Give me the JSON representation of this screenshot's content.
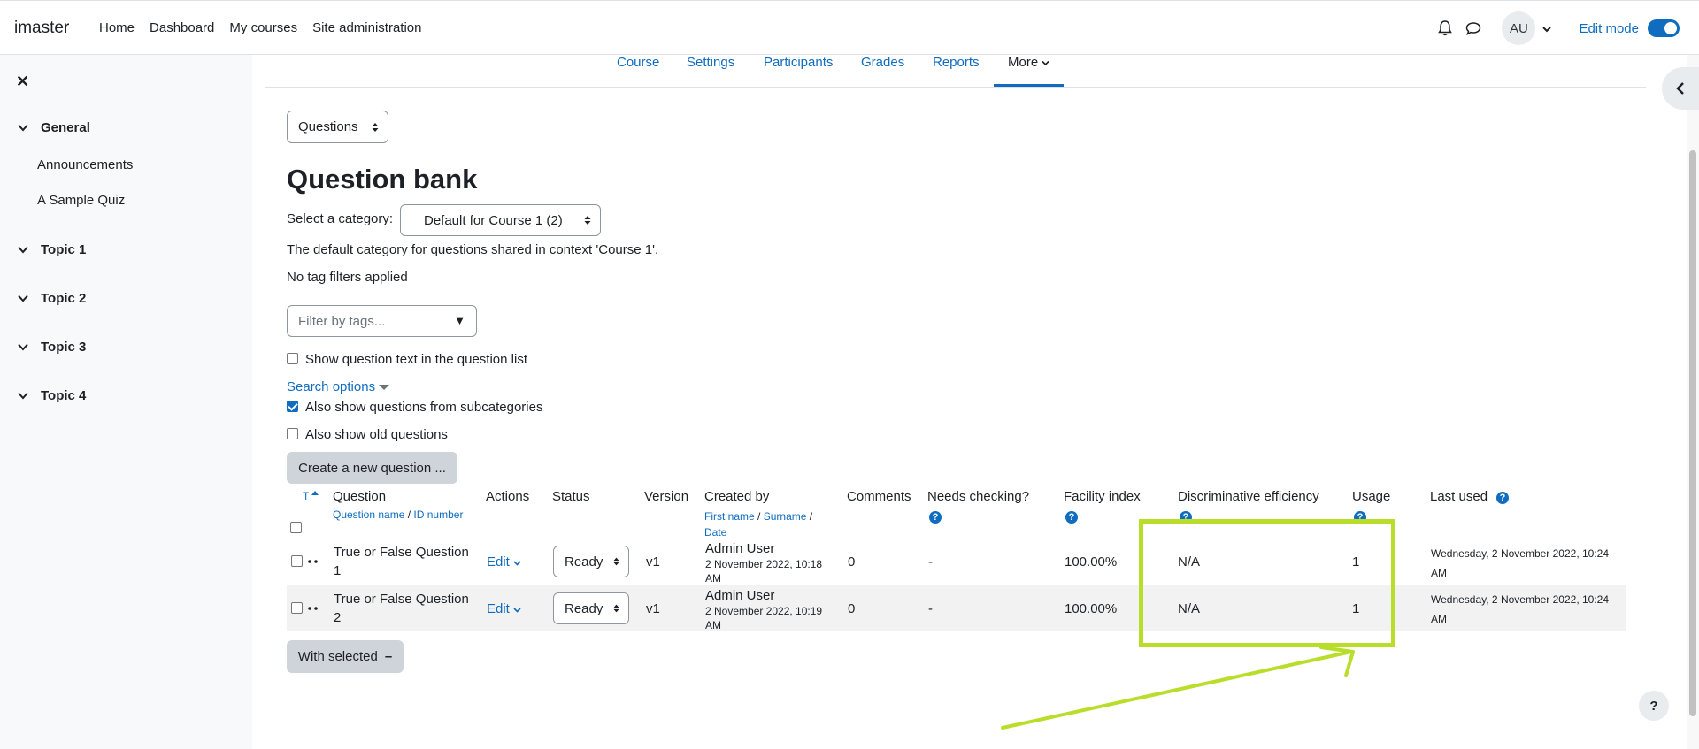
{
  "navbar": {
    "brand": "imaster",
    "links": [
      "Home",
      "Dashboard",
      "My courses",
      "Site administration"
    ],
    "avatar_initials": "AU",
    "edit_mode_label": "Edit mode",
    "edit_mode_on": true
  },
  "drawer": {
    "close_icon": "close-icon",
    "sections": [
      {
        "label": "General",
        "items": [
          "Announcements",
          "A Sample Quiz"
        ]
      },
      {
        "label": "Topic 1",
        "items": []
      },
      {
        "label": "Topic 2",
        "items": []
      },
      {
        "label": "Topic 3",
        "items": []
      },
      {
        "label": "Topic 4",
        "items": []
      }
    ]
  },
  "secondary_nav": {
    "items": [
      "Course",
      "Settings",
      "Participants",
      "Grades",
      "Reports",
      "More"
    ],
    "active": "More"
  },
  "bank_select": "Questions",
  "title": "Question bank",
  "category": {
    "label": "Select a category:",
    "value": "Default for Course 1 (2)",
    "description": "The default category for questions shared in context 'Course 1'."
  },
  "tags": {
    "status": "No tag filters applied",
    "placeholder": "Filter by tags..."
  },
  "options": {
    "show_text_label": "Show question text in the question list",
    "show_text_checked": false,
    "search_options_label": "Search options",
    "subcategories_label": "Also show questions from subcategories",
    "subcategories_checked": true,
    "old_label": "Also show old questions",
    "old_checked": false
  },
  "create_button": "Create a new question ...",
  "table": {
    "headers": {
      "type": "T",
      "question": "Question",
      "question_sub_name": "Question name",
      "question_sub_sep": "/",
      "question_sub_id": "ID number",
      "actions": "Actions",
      "status": "Status",
      "version": "Version",
      "created_by": "Created by",
      "created_sub_first": "First name",
      "created_sub_sep1": "/",
      "created_sub_surname": "Surname",
      "created_sub_sep2": "/",
      "created_sub_date": "Date",
      "comments": "Comments",
      "needs_checking": "Needs checking?",
      "facility": "Facility index",
      "discrimination": "Discriminative efficiency",
      "usage": "Usage",
      "last_used": "Last used"
    },
    "rows": [
      {
        "name_line1": "True or False Question",
        "name_line2": "1",
        "action": "Edit",
        "status": "Ready",
        "version": "v1",
        "creator": "Admin User",
        "created_line1": "2 November 2022, 10:18",
        "created_line2": "AM",
        "comments": "0",
        "needs_checking": "-",
        "facility": "100.00%",
        "discrimination": "N/A",
        "usage": "1",
        "last_used_line1": "Wednesday, 2 November 2022, 10:24",
        "last_used_line2": "AM"
      },
      {
        "name_line1": "True or False Question",
        "name_line2": "2",
        "action": "Edit",
        "status": "Ready",
        "version": "v1",
        "creator": "Admin User",
        "created_line1": "2 November 2022, 10:19",
        "created_line2": "AM",
        "comments": "0",
        "needs_checking": "-",
        "facility": "100.00%",
        "discrimination": "N/A",
        "usage": "1",
        "last_used_line1": "Wednesday, 2 November 2022, 10:24",
        "last_used_line2": "AM"
      }
    ]
  },
  "with_selected_button": "With selected",
  "help_fab": "?",
  "annotation_color": "#b8de2a"
}
